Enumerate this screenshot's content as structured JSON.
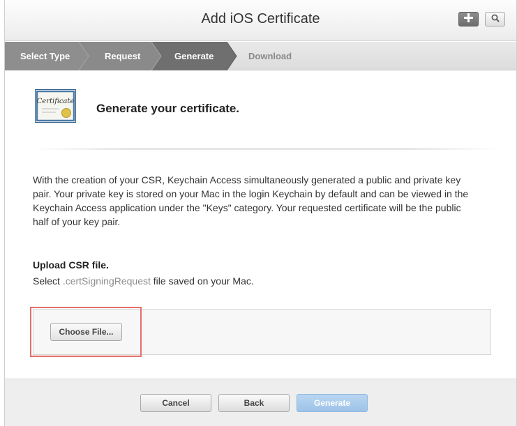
{
  "header": {
    "title": "Add iOS Certificate",
    "add_icon": "plus-icon",
    "search_icon": "search-icon"
  },
  "steps": [
    {
      "label": "Select Type",
      "state": "done"
    },
    {
      "label": "Request",
      "state": "done"
    },
    {
      "label": "Generate",
      "state": "active"
    },
    {
      "label": "Download",
      "state": "pending"
    }
  ],
  "intro": {
    "icon_text": "Certificate",
    "heading": "Generate your certificate."
  },
  "description": "With the creation of your CSR, Keychain Access simultaneously generated a public and private key pair. Your private key is stored on your Mac in the login Keychain by default and can be viewed in the Keychain Access application under the \"Keys\" category. Your requested certificate will be the public half of your key pair.",
  "upload": {
    "heading": "Upload CSR file.",
    "sub_prefix": "Select ",
    "sub_ext": ".certSigningRequest",
    "sub_suffix": " file saved on your Mac.",
    "choose_label": "Choose File..."
  },
  "footer": {
    "cancel_label": "Cancel",
    "back_label": "Back",
    "generate_label": "Generate"
  },
  "colors": {
    "highlight": "#e4706a",
    "step_done": "#8e8e8e",
    "step_active": "#6f6f6f",
    "generate_disabled": "#a9cbeb"
  }
}
